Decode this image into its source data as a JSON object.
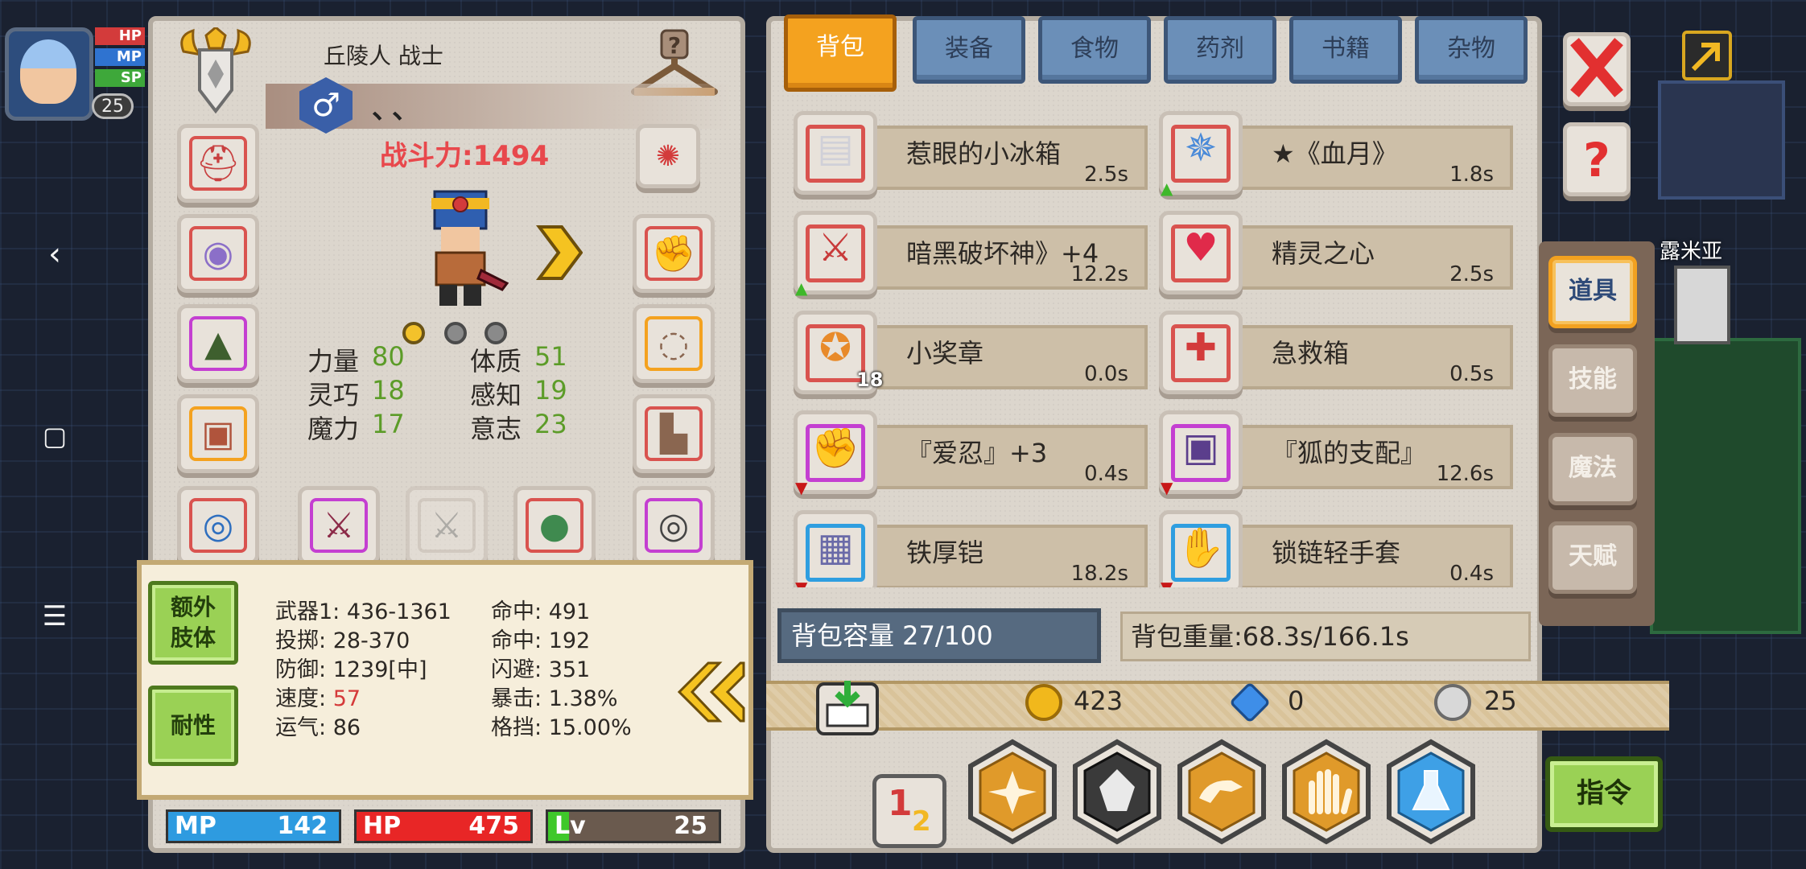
{
  "status_mini": {
    "hp": "HP",
    "mp": "MP",
    "sp": "SP",
    "level": "25"
  },
  "character": {
    "class_title": "丘陵人 战士",
    "gender_symbol": "♂",
    "name": "、、",
    "power": "战斗力:1494"
  },
  "attributes": [
    {
      "label": "力量",
      "value": "80"
    },
    {
      "label": "体质",
      "value": "51"
    },
    {
      "label": "灵巧",
      "value": "18"
    },
    {
      "label": "感知",
      "value": "19"
    },
    {
      "label": "魔力",
      "value": "17"
    },
    {
      "label": "意志",
      "value": "23"
    }
  ],
  "detail": {
    "extra_limbs": "额外\n肢体",
    "resistance": "耐性",
    "lines_left": [
      {
        "label": "武器1:",
        "value": "436-1361"
      },
      {
        "label": "投掷:",
        "value": "28-370"
      },
      {
        "label": "防御:",
        "value": "1239[中]"
      },
      {
        "label": "速度:",
        "value": "57"
      },
      {
        "label": "运气:",
        "value": "86"
      }
    ],
    "lines_right": [
      {
        "label": "命中:",
        "value": "491"
      },
      {
        "label": "命中:",
        "value": "192"
      },
      {
        "label": "闪避:",
        "value": "351"
      },
      {
        "label": "暴击:",
        "value": "1.38%"
      },
      {
        "label": "格挡:",
        "value": "15.00%"
      }
    ]
  },
  "vitals": {
    "mp_label": "MP",
    "mp_value": "142",
    "hp_label": "HP",
    "hp_value": "475",
    "lv_label": "Lv",
    "lv_value": "25"
  },
  "tabs": [
    "背包",
    "装备",
    "食物",
    "药剂",
    "书籍",
    "杂物"
  ],
  "items": [
    {
      "name": "惹眼的小冰箱",
      "time": "2.5s",
      "qty": "",
      "mark": "",
      "ring": "#d9534f",
      "icon": "fridge-icon"
    },
    {
      "name": "★《血月》",
      "time": "1.8s",
      "qty": "",
      "mark": "▲",
      "ring": "#d9534f",
      "icon": "staff-icon"
    },
    {
      "name": "暗黑破坏神》+4",
      "time": "12.2s",
      "qty": "",
      "mark": "▲",
      "ring": "#d9534f",
      "icon": "sword-icon"
    },
    {
      "name": "精灵之心",
      "time": "2.5s",
      "qty": "",
      "mark": "",
      "ring": "#d9534f",
      "icon": "heart-icon"
    },
    {
      "name": "小奖章",
      "time": "0.0s",
      "qty": "18",
      "mark": "",
      "ring": "#d9534f",
      "icon": "medal-icon"
    },
    {
      "name": "急救箱",
      "time": "0.5s",
      "qty": "",
      "mark": "",
      "ring": "#d9534f",
      "icon": "first-aid-icon"
    },
    {
      "name": "『爱忍』+3",
      "time": "0.4s",
      "qty": "",
      "mark": "▼",
      "ring": "#c43fd1",
      "icon": "gauntlet-icon"
    },
    {
      "name": "『狐的支配』",
      "time": "12.6s",
      "qty": "",
      "mark": "▼",
      "ring": "#c43fd1",
      "icon": "armor-icon"
    },
    {
      "name": "铁厚铠",
      "time": "18.2s",
      "qty": "",
      "mark": "▼",
      "ring": "#2f9ee0",
      "icon": "plate-armor-icon"
    },
    {
      "name": "锁链轻手套",
      "time": "0.4s",
      "qty": "",
      "mark": "▼",
      "ring": "#2f9ee0",
      "icon": "glove-icon"
    }
  ],
  "bag": {
    "capacity": "背包容量 27/100",
    "weight": "背包重量:68.3s/166.1s"
  },
  "currency": {
    "gold": "423",
    "gem": "0",
    "silver": "25"
  },
  "side_tabs": [
    "道具",
    "技能",
    "魔法",
    "天赋"
  ],
  "command": "指令",
  "map_label": "露米亚",
  "colors": {
    "accent": "#f4a21f",
    "power": "#e8484c",
    "positive": "#5c9c28",
    "negative": "#d53a3a"
  }
}
